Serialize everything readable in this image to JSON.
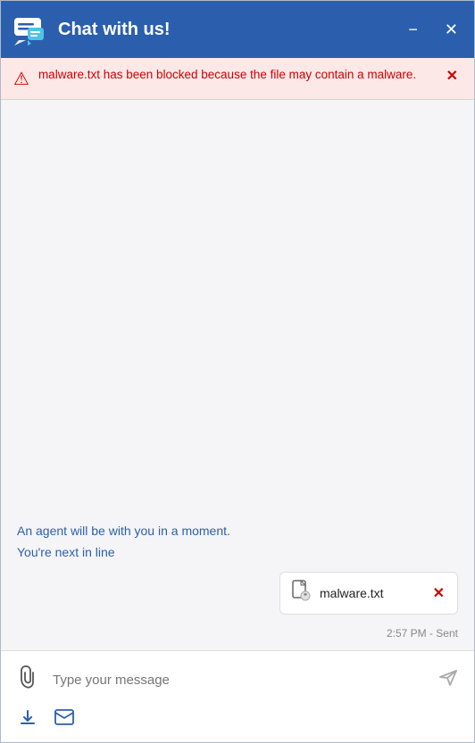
{
  "titleBar": {
    "title": "Chat with us!",
    "minimizeLabel": "−",
    "closeLabel": "✕"
  },
  "alert": {
    "text": "malware.txt has been blocked because the file may contain a malware.",
    "closeLabel": "✕"
  },
  "chat": {
    "systemMessage1": "An agent will be with you in a moment.",
    "systemMessage2": "You're next in line",
    "attachment": {
      "fileName": "malware.txt"
    },
    "timestamp": "2:57 PM - Sent"
  },
  "inputArea": {
    "placeholder": "Type your message"
  },
  "icons": {
    "chat": "chat-icon",
    "alert": "⚠",
    "attach": "📎",
    "send": "➤",
    "download": "↓",
    "email": "✉"
  }
}
